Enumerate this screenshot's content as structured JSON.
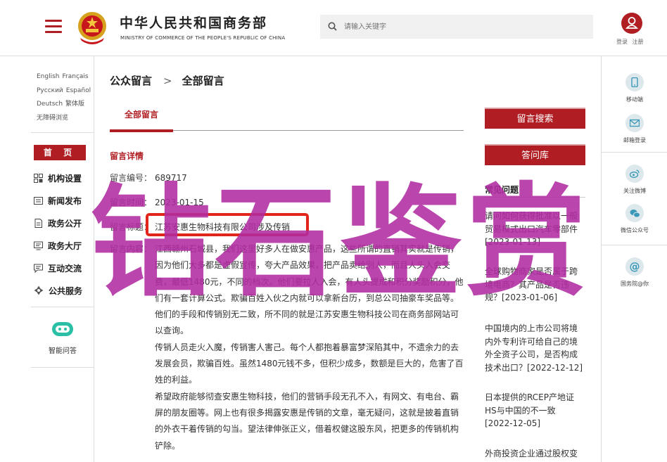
{
  "header": {
    "site_name": "中华人民共和国商务部",
    "site_sub": "MINISTRY OF COMMERCE OF THE PEOPLE'S REPUBLIC OF CHINA",
    "search_placeholder": "请输入关键字",
    "login": "登录",
    "register": "注册"
  },
  "languages": [
    "English",
    "Français",
    "Русский",
    "Español",
    "Deutsch",
    "繁体版",
    "无障碍浏览"
  ],
  "sidebar": {
    "home": "首 页",
    "items": [
      {
        "label": "机构设置",
        "icon": "org-grid-icon"
      },
      {
        "label": "新闻发布",
        "icon": "news-icon"
      },
      {
        "label": "政务公开",
        "icon": "document-icon"
      },
      {
        "label": "政务大厅",
        "icon": "monitor-icon"
      },
      {
        "label": "互动交流",
        "icon": "chat-icon"
      },
      {
        "label": "公共服务",
        "icon": "service-icon"
      }
    ],
    "assistant": "智能问答"
  },
  "breadcrumb": {
    "root": "公众留言",
    "current": "全部留言"
  },
  "tab": "全部留言",
  "detail": {
    "section_title": "留言详情",
    "number_label": "留言编号：",
    "number_value": "689717",
    "time_label": "留言时间：",
    "time_value": "2023-01-15",
    "topic_label": "留言标题：",
    "topic_value": "江苏安惠生物科技有限公司涉及传销",
    "content_label": "留言内容：",
    "content": [
      "江西赣州石城县，我们这里好多人在做安惠产品，这些所谓的直销其实就是传销，因为他们大多都是虚假宣传，夸大产品效果，把产品卖给别人，而且人头入会交费，最低1480元，不同的档次。他们要拉人入会，有人头提成和积分奖励积分，他们有一套计算公式。欺骗百姓入伙之内就可以拿新台历，到总公司抽豪车奖品等。他们的手段和传销别无二致，所不同的就是江苏安惠生物科技公司在商务部网站可以查询。",
      "传销人员走火入魔，传销害人害己。每个人都抱着暴富梦深陷其中，不遗余力的去发展会员，欺骗百姓。虽然1480元钱不多，但积少成多，数额是巨大的，危害了百姓的利益。",
      "希望政府能够彻查安惠生物科技，他们的营销手段无孔不入，有网文、有电台、霸屏的朋友圈等。网上也有很多揭露安惠是传销的文章，毫无疑问，这就是披着直销的外衣干着传销的勾当。望法律伸张正义，借着权健这股东风，把更多的传销机构铲除。"
    ]
  },
  "right": {
    "search_btn": "留言搜索",
    "faq_btn": "答问库",
    "faq_title": "常见问题",
    "faqs": [
      "请问如何获得批准以一般贸易模式出口汽车零部件 [2023-01-13]",
      "全球购物商家是否属于跨境电商？其产品是否违规？[2023-01-06]",
      "中国境内的上市公司将境内外专利许可给自己的境外全资子公司，是否构成技术出口？[2022-12-12]",
      "日本提供的RCEP产地证HS与中国的不一致[2022-12-05]",
      "外商投资企业通过股权变"
    ]
  },
  "rail": {
    "mobile": "移动端",
    "mail": "邮箱登录",
    "weibo": "关注微博",
    "wechat": "微信公众号",
    "ask": "国务院@你"
  },
  "watermark": "钻石鉴赏",
  "colors": {
    "brand": "#b01e23",
    "watermark": "#b02ba0",
    "highlight": "#e1251b"
  }
}
